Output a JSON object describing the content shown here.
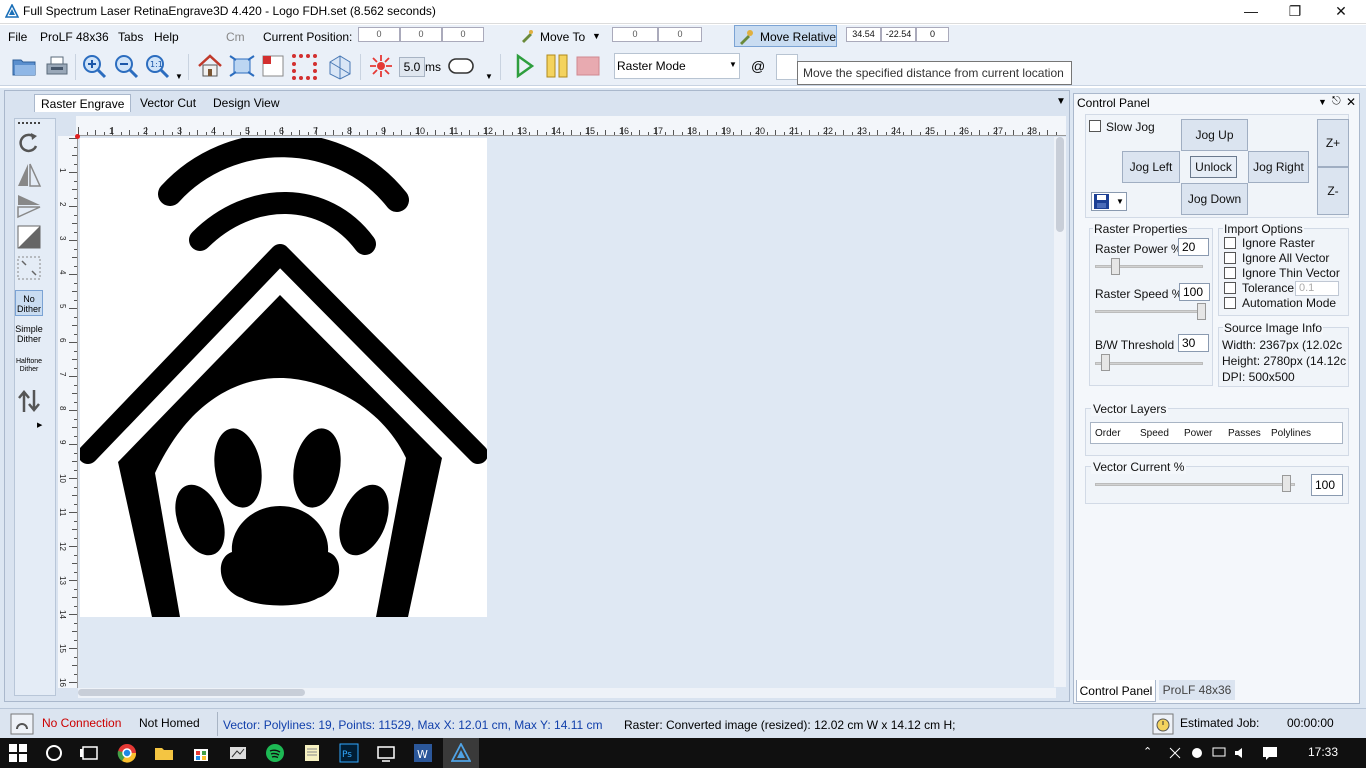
{
  "window": {
    "title": "Full Spectrum Laser RetinaEngrave3D 4.420 - Logo FDH.set (8.562 seconds)"
  },
  "menu": {
    "file": "File",
    "model": "ProLF 48x36",
    "tabs": "Tabs",
    "help": "Help",
    "units": "Cm",
    "current_position_label": "Current Position:",
    "pos": [
      "0",
      "0",
      "0"
    ],
    "move_to": "Move To",
    "move_to_vals": [
      "0",
      "0"
    ],
    "move_relative": "Move Relative",
    "move_relative_vals": [
      "34.54",
      "-22.54",
      "0"
    ]
  },
  "toolbar": {
    "pulse": "5.0",
    "pulse_unit": "ms",
    "mode": "Raster Mode",
    "at": "@"
  },
  "tooltip": "Move the specified distance from current location",
  "doc_tabs": [
    "Raster Engrave",
    "Vector Cut",
    "Design View"
  ],
  "left_tools": {
    "no_dither": [
      "No",
      "Dither"
    ],
    "simple_dither": [
      "Simple",
      "Dither"
    ],
    "halftone_dither": [
      "Halftone",
      "Dither"
    ]
  },
  "ruler": {
    "top": [
      "1",
      "2",
      "3",
      "4",
      "5",
      "6",
      "7",
      "8",
      "9",
      "10",
      "11",
      "12",
      "13",
      "14",
      "15",
      "16",
      "17",
      "18",
      "19",
      "20",
      "21",
      "22",
      "23",
      "24",
      "25",
      "26",
      "27",
      "28"
    ],
    "left": [
      "1",
      "2",
      "3",
      "4",
      "5",
      "6",
      "7",
      "8",
      "9",
      "10",
      "11",
      "12",
      "13",
      "14",
      "15",
      "16"
    ]
  },
  "control_panel": {
    "title": "Control Panel",
    "slow_jog": "Slow Jog",
    "jog_up": "Jog Up",
    "jog_left": "Jog Left",
    "unlock": "Unlock",
    "jog_right": "Jog Right",
    "jog_down": "Jog Down",
    "z_plus": "Z+",
    "z_minus": "Z-",
    "raster_properties": {
      "title": "Raster Properties",
      "power_label": "Raster Power %",
      "power": "20",
      "power_level": 0.2,
      "speed_label": "Raster Speed %",
      "speed": "100",
      "speed_level": 1.0,
      "threshold_label": "B/W Threshold",
      "threshold": "30",
      "threshold_level": 0.05
    },
    "import_options": {
      "title": "Import Options",
      "items": [
        "Ignore Raster",
        "Ignore All Vector",
        "Ignore Thin Vector",
        "Tolerance",
        "Automation Mode"
      ],
      "tolerance_placeholder": "0.1"
    },
    "source_info": {
      "title": "Source Image Info",
      "width": "Width:  2367px (12.02c",
      "height": "Height: 2780px (14.12c",
      "dpi": "DPI: 500x500"
    },
    "vector_layers": {
      "title": "Vector Layers",
      "columns": [
        "Order",
        "Speed",
        "Power",
        "Passes",
        "Polylines"
      ]
    },
    "vector_current": {
      "title": "Vector Current %",
      "value": "100",
      "level": 1.0
    },
    "bottom_tabs": [
      "Control Panel",
      "ProLF 48x36"
    ]
  },
  "status": {
    "connection": "No Connection",
    "homed": "Not Homed",
    "vector_info": "Vector: Polylines: 19, Points: 11529, Max X: 12.01 cm, Max Y: 14.11 cm",
    "raster_info": "Raster: Converted image (resized): 12.02 cm W x 14.12 cm H;",
    "estimated_label": "Estimated Job:",
    "estimated_time": "00:00:00"
  },
  "taskbar": {
    "time": "17:33"
  },
  "colors": {
    "accent": "#0b5bd6",
    "status_error": "#cc0000",
    "status_info": "#1240ab"
  }
}
